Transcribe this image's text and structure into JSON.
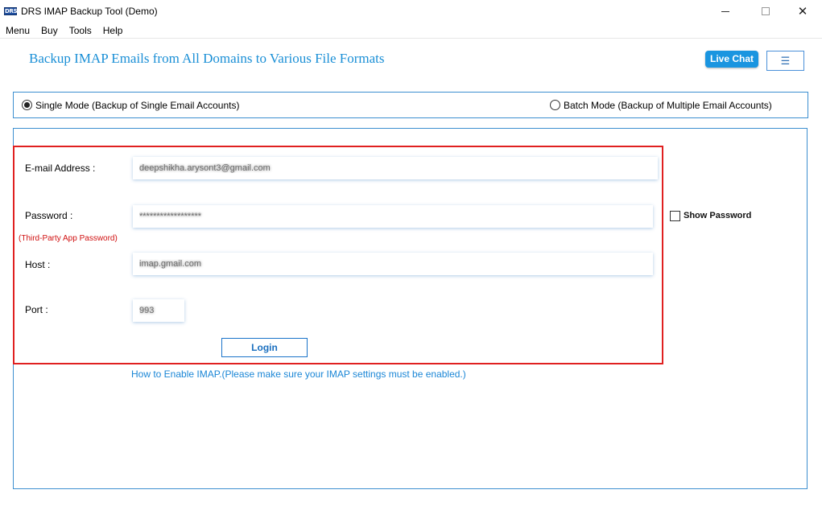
{
  "window": {
    "app_icon_text": "DRS",
    "title": "DRS IMAP Backup Tool (Demo)",
    "minimize_glyph": "",
    "maximize_glyph": "",
    "close_glyph": "✕"
  },
  "menu": {
    "items": [
      "Menu",
      "Buy",
      "Tools",
      "Help"
    ]
  },
  "header": {
    "title": "Backup IMAP Emails from All Domains to Various File Formats",
    "live_chat_label": "Live Chat",
    "hamburger_glyph": "☰"
  },
  "modes": {
    "single_label": "Single Mode (Backup of Single Email Accounts)",
    "batch_label": "Batch Mode (Backup of Multiple Email Accounts)",
    "selected": "single"
  },
  "form": {
    "email_label": "E-mail Address :",
    "email_value": "deepshikha.arysont3@gmail.com",
    "password_label": "Password :",
    "password_value": "******************",
    "app_password_note": "(Third-Party App Password)",
    "host_label": "Host :",
    "host_value": "imap.gmail.com",
    "port_label": "Port :",
    "port_value": "993",
    "show_password_label": "Show Password",
    "show_password_checked": false,
    "login_label": "Login",
    "imap_link": "How to Enable IMAP.(Please make sure your IMAP settings must be enabled.)"
  },
  "colors": {
    "accent": "#1a8fd6",
    "highlight_border": "#e02020",
    "panel_border": "#3d8fd0",
    "note_red": "#d01010"
  }
}
